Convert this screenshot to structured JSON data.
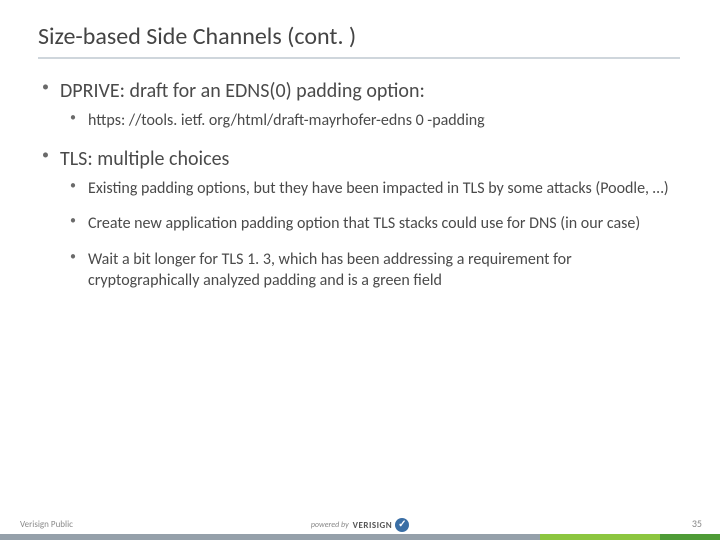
{
  "title": "Size-based Side Channels (cont. )",
  "bullets": [
    {
      "text": "DPRIVE:  draft for an EDNS(0) padding option:",
      "sub": [
        "https: //tools. ietf. org/html/draft-mayrhofer-edns 0 -padding"
      ]
    },
    {
      "text": "TLS:  multiple choices",
      "sub": [
        "Existing padding options, but they have been impacted in TLS by some attacks (Poodle, …)",
        "Create new application padding option that TLS stacks could use for DNS (in our case)",
        "Wait a bit longer for TLS 1. 3, which has been addressing a requirement for cryptographically analyzed padding and is a green field"
      ]
    }
  ],
  "footer": {
    "classification": "Verisign Public",
    "powered_prefix": "powered by",
    "logo_text": "VERISIGN",
    "page_number": "35"
  }
}
